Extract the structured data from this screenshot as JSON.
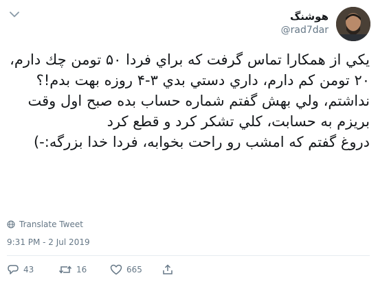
{
  "author": {
    "display_name": "هوشنگ",
    "handle": "@rad7dar"
  },
  "tweet": {
    "text": "يكي از همكارا تماس گرفت كه براي فردا ۵۰ تومن چك دارم، ۲۰ تومن كم دارم، داري دستي بدي ۳-۴ روزه بهت بدم!؟\nنداشتم، ولي بهش گفتم شماره حساب بده صبح اول وقت بريزم به حسابت، كلي تشكر كرد و قطع كرد\nدروغ گفتم كه امشب رو راحت بخوابه، فردا خدا بزرگه:-)",
    "translate_label": "Translate Tweet",
    "timestamp": "9:31 PM - 2 Jul 2019"
  },
  "actions": {
    "replies": "43",
    "retweets": "16",
    "likes": "665"
  },
  "icons": [
    "chevron-down-icon",
    "globe-icon",
    "reply-icon",
    "retweet-icon",
    "like-icon",
    "share-icon"
  ],
  "colors": {
    "text": "#14171a",
    "secondary": "#657786",
    "divider": "#e6ecf0"
  }
}
